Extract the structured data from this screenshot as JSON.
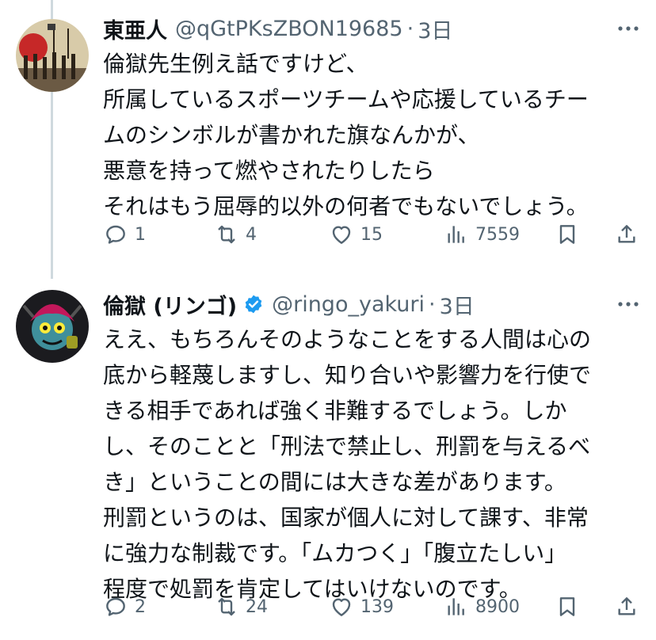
{
  "tweets": [
    {
      "author": "東亜人",
      "handle": "@qGtPKsZBON19685",
      "separator": "·",
      "time": "3日",
      "verified": false,
      "lines": [
        "倫獄先生例え話ですけど、",
        "所属しているスポーツチームや応援しているチー",
        "ムのシンボルが書かれた旗なんかが、",
        "悪意を持って燃やされたりしたら",
        "それはもう屈辱的以外の何者でもないでしょう。"
      ],
      "stats": {
        "replies": "1",
        "retweets": "4",
        "likes": "15",
        "views": "7559"
      }
    },
    {
      "author": "倫獄 (リンゴ)",
      "handle": "@ringo_yakuri",
      "separator": "·",
      "time": "3日",
      "verified": true,
      "lines": [
        "ええ、もちろんそのようなことをする人間は心の",
        "底から軽蔑しますし、知り合いや影響力を行使で",
        "きる相手であれば強く非難するでしょう。しか",
        "し、そのことと「刑法で禁止し、刑罰を与えるべ",
        "き」ということの間には大きな差があります。",
        "刑罰というのは、国家が個人に対して課す、非常",
        "に強力な制裁です。「ムカつく」「腹立たしい」",
        "程度で処罰を肯定してはいけないのです。"
      ],
      "stats": {
        "replies": "2",
        "retweets": "24",
        "likes": "139",
        "views": "8900"
      }
    }
  ],
  "colors": {
    "text": "#0f1419",
    "secondary": "#536471",
    "verified": "#1d9bf0",
    "thread_line": "#cfd9de"
  },
  "icons": [
    "reply-icon",
    "retweet-icon",
    "like-icon",
    "views-icon",
    "bookmark-icon",
    "share-icon",
    "more-icon",
    "verified-badge-icon"
  ]
}
